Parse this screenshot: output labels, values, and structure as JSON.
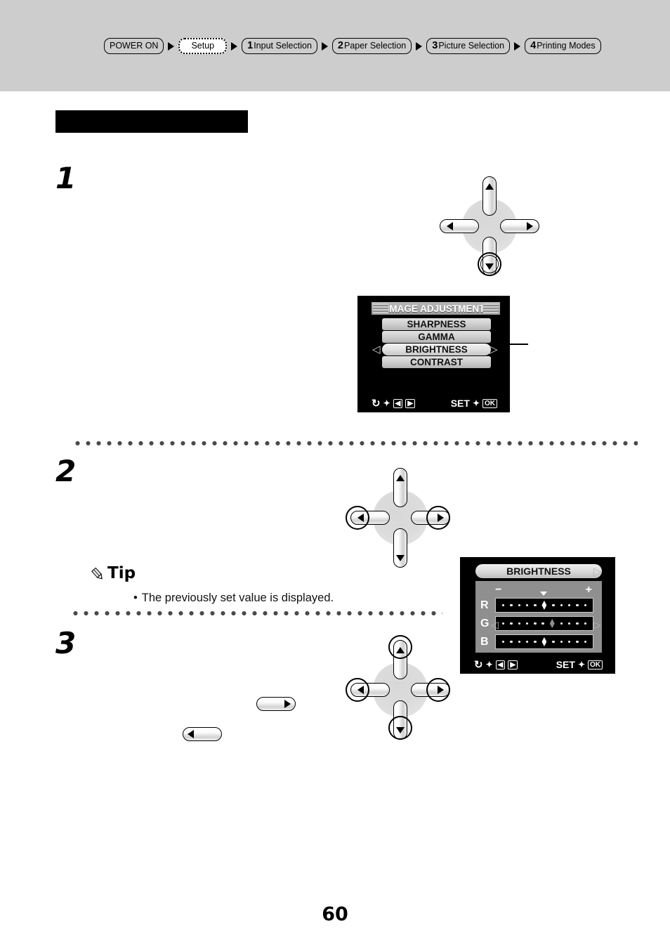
{
  "breadcrumb": {
    "items": [
      {
        "num": "",
        "label": "POWER ON",
        "style": "solid"
      },
      {
        "num": "",
        "label": "Setup",
        "style": "dotted"
      },
      {
        "num": "1",
        "label": "Input Selection",
        "style": "solid"
      },
      {
        "num": "2",
        "label": "Paper Selection",
        "style": "solid"
      },
      {
        "num": "3",
        "label": "Picture Selection",
        "style": "solid"
      },
      {
        "num": "4",
        "label": "Printing Modes",
        "style": "solid"
      }
    ]
  },
  "section": {
    "heading_bar_text": ""
  },
  "steps": {
    "one": "1",
    "two": "2",
    "three": "3"
  },
  "tip": {
    "icon": "pencil-icon",
    "title": "Tip",
    "bullet": "•",
    "text": "The previously set value is displayed."
  },
  "lcd_image_adjustment": {
    "title": "IMAGE ADJUSTMENT",
    "menu_items": [
      {
        "label": "SHARPNESS",
        "selected": false
      },
      {
        "label": "GAMMA",
        "selected": false
      },
      {
        "label": "BRIGHTNESS",
        "selected": true
      },
      {
        "label": "CONTRAST",
        "selected": false
      }
    ],
    "left_caret": "◁",
    "right_caret": "▷",
    "footer": {
      "loop_icon": "↻",
      "arrow": "✦",
      "left_key": "◀",
      "right_key": "▶",
      "set_label": "SET",
      "set_arrow": "✦",
      "ok_key": "OK"
    }
  },
  "lcd_brightness": {
    "title": "BRIGHTNESS",
    "minus_label": "−",
    "plus_label": "+",
    "left_caret": "◁",
    "right_caret": "▷",
    "channels": [
      {
        "label": "R",
        "dots": 11,
        "marker_index": 5,
        "marker_dim": false
      },
      {
        "label": "G",
        "dots": 11,
        "marker_index": 6,
        "marker_dim": true
      },
      {
        "label": "B",
        "dots": 11,
        "marker_index": 5,
        "marker_dim": false
      }
    ],
    "footer": {
      "loop_icon": "↻",
      "arrow": "✦",
      "left_key": "◀",
      "right_key": "▶",
      "set_label": "SET",
      "set_arrow": "✦",
      "ok_key": "OK"
    }
  },
  "dpads": {
    "step1": {
      "highlighted": [
        "down"
      ]
    },
    "step2": {
      "highlighted": [
        "left",
        "right"
      ]
    },
    "step3": {
      "highlighted": [
        "up",
        "down",
        "left",
        "right"
      ]
    }
  },
  "inline_buttons": {
    "right": "▶",
    "left": "◀"
  },
  "page": {
    "number": "60"
  },
  "colors": {
    "band": "#cdcdcd",
    "ink": "#000000",
    "lcd_bg": "#000000",
    "lcd_panel": "#8f8f8f"
  }
}
